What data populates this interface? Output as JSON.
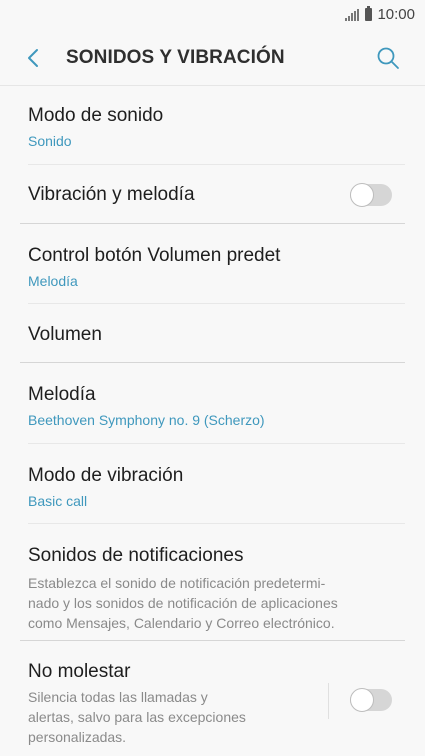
{
  "status_bar": {
    "time": "10:00"
  },
  "header": {
    "title": "SONIDOS Y VIBRACIÓN"
  },
  "items": [
    {
      "label": "Modo de sonido",
      "value": "Sonido"
    },
    {
      "label": "Vibración y melodía",
      "toggle": "off"
    },
    {
      "label": "Control botón Volumen predet",
      "value": "Melodía"
    },
    {
      "label": "Volumen"
    },
    {
      "label": "Melodía",
      "value": "Beethoven Symphony no. 9 (Scherzo)"
    },
    {
      "label": "Modo de vibración",
      "value": "Basic call"
    },
    {
      "label": "Sonidos de notificaciones",
      "description_lines": [
        "Establezca el sonido de notificación predetermi-",
        "nado y los sonidos de notificación de aplicaciones",
        "como Mensajes, Calendario y Correo electrónico."
      ]
    },
    {
      "label": "No molestar",
      "description_lines": [
        "Silencia todas las llamadas y",
        "alertas, salvo para las excepciones",
        "personalizadas."
      ],
      "toggle": "off"
    }
  ],
  "colors": {
    "accent": "#3f98bd",
    "background": "#f8f8f8"
  }
}
